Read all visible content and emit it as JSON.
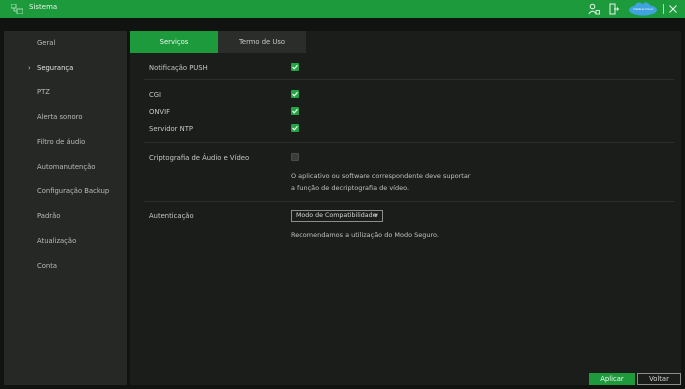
{
  "titlebar": {
    "title": "Sistema",
    "cloud_label": "Intelbras Cloud"
  },
  "sidebar": {
    "items": [
      {
        "label": "Geral"
      },
      {
        "label": "Segurança",
        "active": true
      },
      {
        "label": "PTZ"
      },
      {
        "label": "Alerta sonoro"
      },
      {
        "label": "Filtro de áudio"
      },
      {
        "label": "Automanutenção"
      },
      {
        "label": "Configuração Backup"
      },
      {
        "label": "Padrão"
      },
      {
        "label": "Atualização"
      },
      {
        "label": "Conta"
      }
    ]
  },
  "tabs": [
    {
      "label": "Serviços",
      "active": true
    },
    {
      "label": "Termo de Uso",
      "active": false
    }
  ],
  "settings": {
    "push_label": "Notificação PUSH",
    "push_checked": true,
    "cgi_label": "CGI",
    "cgi_checked": true,
    "onvif_label": "ONVIF",
    "onvif_checked": true,
    "ntp_label": "Servidor NTP",
    "ntp_checked": true,
    "encryption_label": "Criptografia de Áudio e Vídeo",
    "encryption_checked": false,
    "encryption_note_line1": "O aplicativo ou software correspondente deve suportar",
    "encryption_note_line2": "a função de decriptografia de vídeo.",
    "auth_label": "Autenticação",
    "auth_value": "Modo de Compatibilidade",
    "auth_note": "Recomendamos a utilização do Modo Seguro."
  },
  "buttons": {
    "apply": "Aplicar",
    "back": "Voltar"
  },
  "colors": {
    "accent": "#1d9a3c",
    "checkbox_on": "#22a545",
    "background": "#111311",
    "panel": "#1b1d1b",
    "sidebar": "#262826"
  }
}
